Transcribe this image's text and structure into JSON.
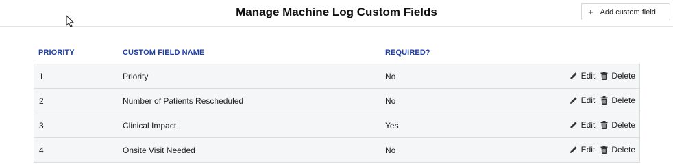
{
  "header": {
    "title": "Manage Machine Log Custom Fields",
    "add_button_label": "Add custom field",
    "add_button_icon": "plus-icon"
  },
  "table": {
    "columns": [
      "PRIORITY",
      "CUSTOM FIELD NAME",
      "REQUIRED?"
    ],
    "rows": [
      {
        "priority": "1",
        "name": "Priority",
        "required": "No"
      },
      {
        "priority": "2",
        "name": "Number of Patients Rescheduled",
        "required": "No"
      },
      {
        "priority": "3",
        "name": "Clinical Impact",
        "required": "Yes"
      },
      {
        "priority": "4",
        "name": "Onsite Visit Needed",
        "required": "No"
      }
    ],
    "actions": {
      "edit_label": "Edit",
      "edit_icon": "pencil-icon",
      "delete_label": "Delete",
      "delete_icon": "trash-icon"
    }
  },
  "colors": {
    "column_header": "#1e3ea8",
    "row_background": "#f5f6f7",
    "border": "#dcdcdc"
  }
}
